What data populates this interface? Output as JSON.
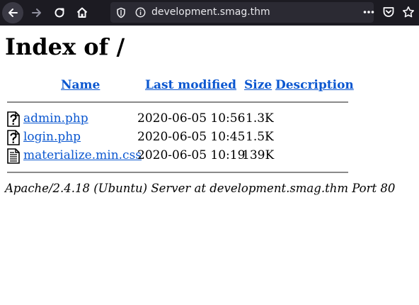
{
  "browser": {
    "url": "development.smag.thm"
  },
  "page": {
    "title": "Index of /",
    "columns": {
      "name": "Name",
      "last_modified": "Last modified",
      "size": "Size",
      "description": "Description"
    },
    "files": [
      {
        "icon": "unknown-file-icon",
        "name": "admin.php",
        "modified": "2020-06-05 10:56",
        "size": "1.3K",
        "description": ""
      },
      {
        "icon": "unknown-file-icon",
        "name": "login.php",
        "modified": "2020-06-05 10:45",
        "size": "1.5K",
        "description": ""
      },
      {
        "icon": "text-file-icon",
        "name": "materialize.min.css",
        "modified": "2020-06-05 10:19",
        "size": "139K",
        "description": ""
      }
    ],
    "footer": "Apache/2.4.18 (Ubuntu) Server at development.smag.thm Port 80"
  },
  "colors": {
    "toolbar_bg": "#1c1b22",
    "urlbar_bg": "#2b2a33",
    "link": "#0b57d0"
  }
}
